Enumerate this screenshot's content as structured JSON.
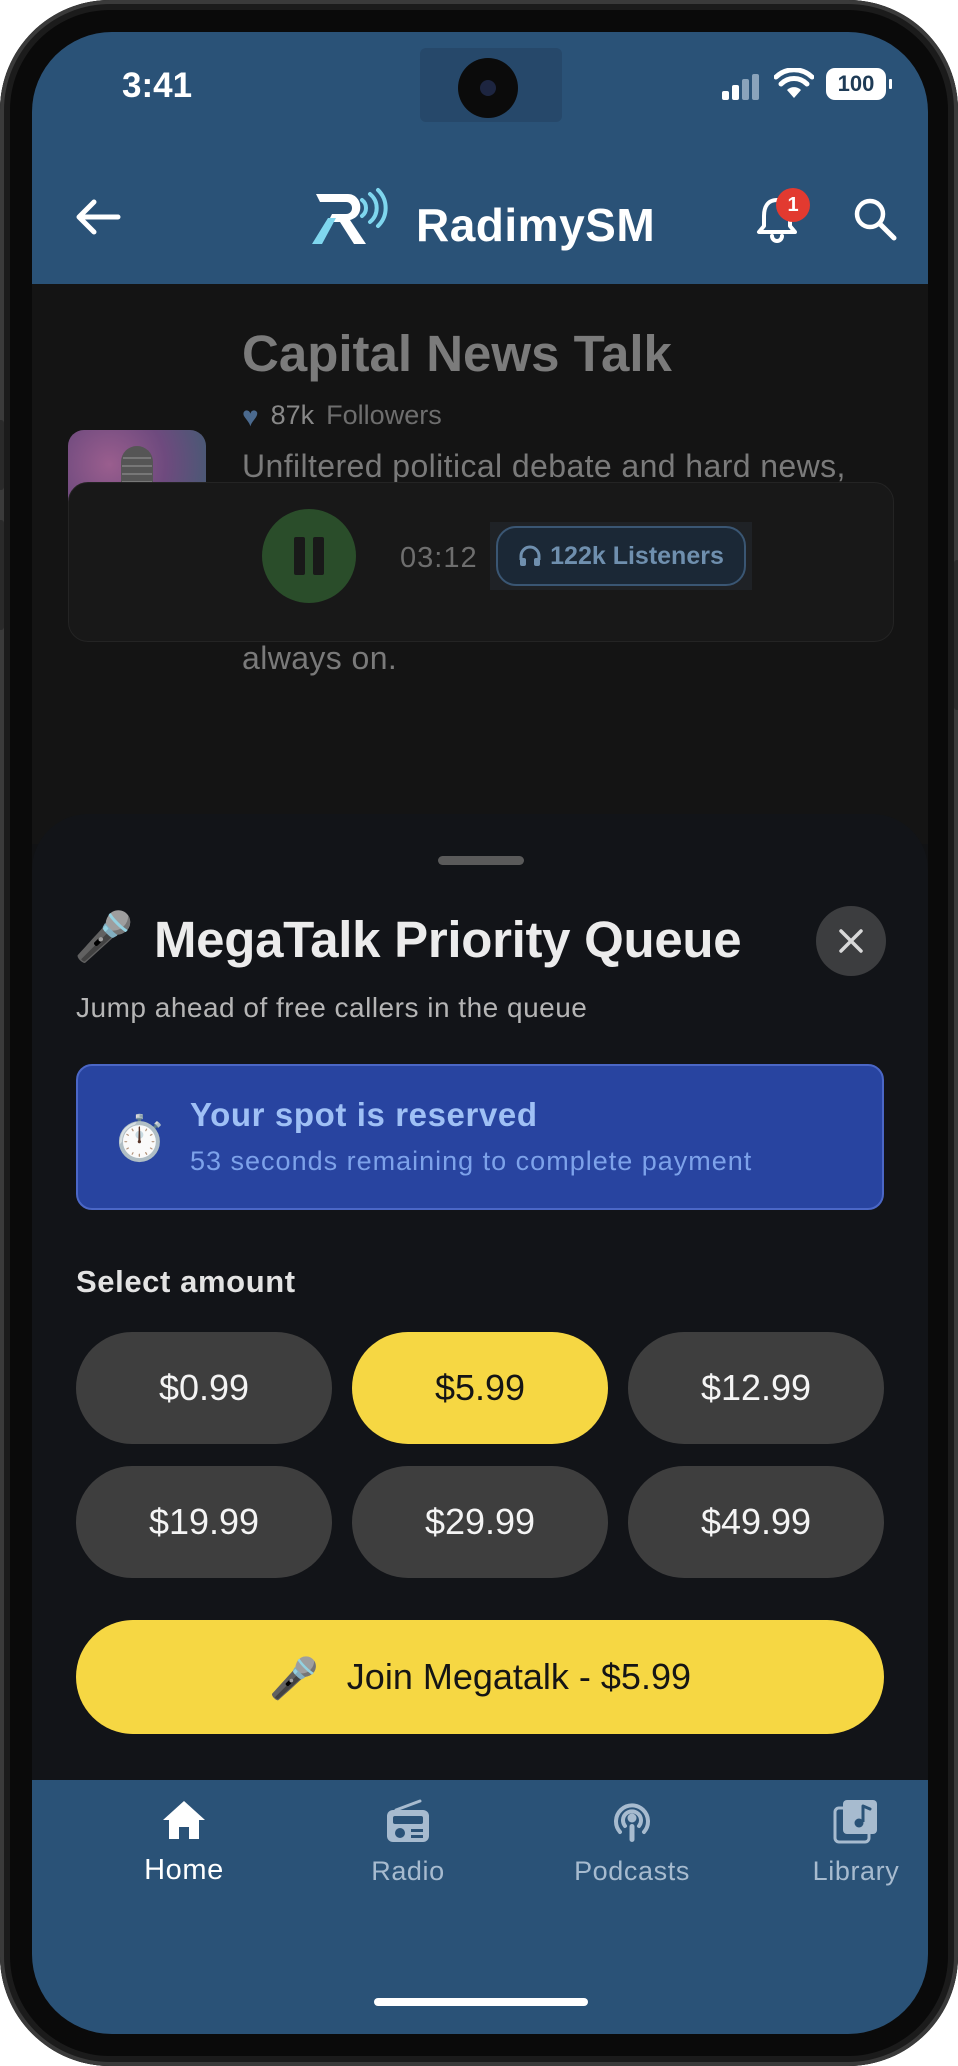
{
  "status": {
    "time": "3:41",
    "battery": "100"
  },
  "header": {
    "app_name": "RadimySM",
    "notification_count": "1"
  },
  "station": {
    "title": "Capital News Talk",
    "followers_count": "87k",
    "followers_label": "Followers",
    "description": "Unfiltered political debate and hard news, day and night. Capital Talkback delivers sharp analysis, open lines and the stories that shape the capital—listener-driven and always on.",
    "elapsed": "03:12",
    "listeners": "122k Listeners"
  },
  "sheet": {
    "title": "MegaTalk Priority Queue",
    "subtitle": "Jump ahead of free callers in the queue",
    "timer_title": "Your spot is reserved",
    "timer_subtitle": "53 seconds remaining to complete payment",
    "select_label": "Select amount",
    "amounts": [
      "$0.99",
      "$5.99",
      "$12.99",
      "$19.99",
      "$29.99",
      "$49.99"
    ],
    "selected_amount": "$5.99",
    "cta_label": "Join Megatalk - $5.99"
  },
  "nav": {
    "items": [
      {
        "label": "Home",
        "icon": "home-icon",
        "active": true
      },
      {
        "label": "Radio",
        "icon": "radio-icon",
        "active": false
      },
      {
        "label": "Podcasts",
        "icon": "podcast-icon",
        "active": false
      },
      {
        "label": "Library",
        "icon": "library-icon",
        "active": false
      }
    ]
  },
  "colors": {
    "brand_blue": "#2a5277",
    "accent_yellow": "#f6d743",
    "timer_blue": "#2844a0",
    "badge_red": "#e23a30"
  }
}
